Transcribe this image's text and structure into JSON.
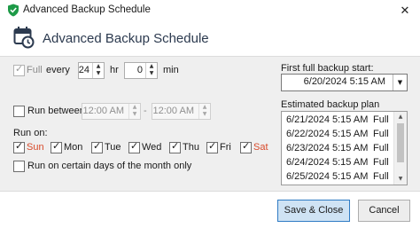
{
  "window": {
    "title": "Advanced Backup Schedule",
    "close_glyph": "✕",
    "icon": "shield-icon"
  },
  "header": {
    "title": "Advanced Backup Schedule",
    "icon": "calendar-clock-icon"
  },
  "colors": {
    "accent": "#2f7bc4",
    "weekend_text": "#d84a2a",
    "header_title": "#2c3a4f"
  },
  "full": {
    "label": "Full",
    "checked": true,
    "disabled": true
  },
  "every": {
    "label": "every",
    "hours_value": "24",
    "hours_unit": "hr",
    "minutes_value": "0",
    "minutes_unit": "min"
  },
  "run_between": {
    "label": "Run between",
    "checked": false,
    "start": "12:00 AM",
    "separator": "-",
    "end": "12:00 AM"
  },
  "run_on": {
    "label": "Run on:",
    "days": [
      {
        "label": "Sun",
        "checked": true,
        "weekend": true
      },
      {
        "label": "Mon",
        "checked": true,
        "weekend": false
      },
      {
        "label": "Tue",
        "checked": true,
        "weekend": false
      },
      {
        "label": "Wed",
        "checked": true,
        "weekend": false
      },
      {
        "label": "Thu",
        "checked": true,
        "weekend": false
      },
      {
        "label": "Fri",
        "checked": true,
        "weekend": false
      },
      {
        "label": "Sat",
        "checked": true,
        "weekend": true
      }
    ]
  },
  "month_days": {
    "label": "Run on certain days of the month only",
    "checked": false
  },
  "first_backup": {
    "label": "First full backup start:",
    "value": "6/20/2024 5:15 AM"
  },
  "estimated_plan": {
    "label": "Estimated backup plan",
    "rows": [
      {
        "date": "6/21/2024 5:15 AM",
        "type": "Full"
      },
      {
        "date": "6/22/2024 5:15 AM",
        "type": "Full"
      },
      {
        "date": "6/23/2024 5:15 AM",
        "type": "Full"
      },
      {
        "date": "6/24/2024 5:15 AM",
        "type": "Full"
      },
      {
        "date": "6/25/2024 5:15 AM",
        "type": "Full"
      }
    ]
  },
  "buttons": {
    "save_close": "Save & Close",
    "cancel": "Cancel"
  }
}
